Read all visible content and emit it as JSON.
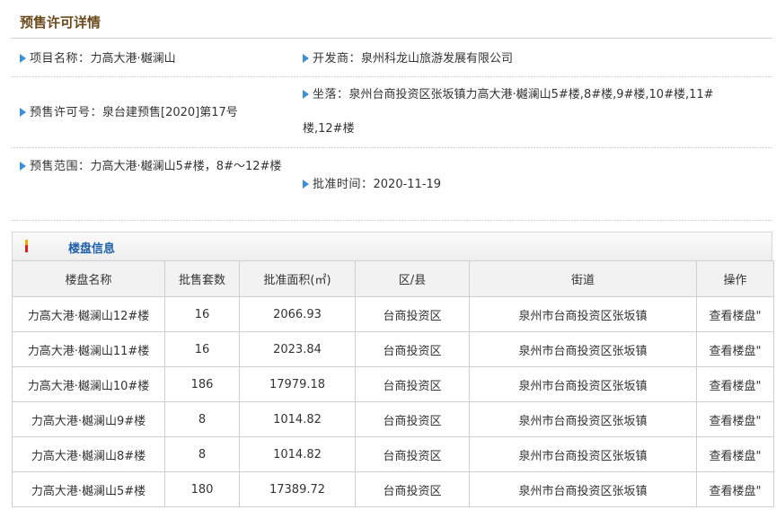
{
  "page": {
    "title": "预售许可详情"
  },
  "info": {
    "project_name_label": "项目名称：",
    "project_name_value": "力高大港·樾澜山",
    "developer_label": "开发商：",
    "developer_value": "泉州科龙山旅游发展有限公司",
    "permit_no_label": "预售许可号：",
    "permit_no_value": "泉台建预售[2020]第17号",
    "location_label": "坐落：",
    "location_value": "泉州台商投资区张坂镇力高大港·樾澜山5#楼,8#楼,9#楼,10#楼,11#楼,12#楼",
    "scope_label": "预售范围：",
    "scope_value": "力高大港·樾澜山5#楼，8#～12#楼",
    "approve_time_label": "批准时间：",
    "approve_time_value": "2020-11-19"
  },
  "building_section": {
    "title": "楼盘信息",
    "columns": [
      "楼盘名称",
      "批售套数",
      "批准面积(㎡)",
      "区/县",
      "街道",
      "操作"
    ],
    "rows": [
      {
        "name": "力高大港·樾澜山12#楼",
        "units": "16",
        "area": "2066.93",
        "district": "台商投资区",
        "street": "泉州市台商投资区张坂镇",
        "action": "查看楼盘\""
      },
      {
        "name": "力高大港·樾澜山11#楼",
        "units": "16",
        "area": "2023.84",
        "district": "台商投资区",
        "street": "泉州市台商投资区张坂镇",
        "action": "查看楼盘\""
      },
      {
        "name": "力高大港·樾澜山10#楼",
        "units": "186",
        "area": "17979.18",
        "district": "台商投资区",
        "street": "泉州市台商投资区张坂镇",
        "action": "查看楼盘\""
      },
      {
        "name": "力高大港·樾澜山9#楼",
        "units": "8",
        "area": "1014.82",
        "district": "台商投资区",
        "street": "泉州市台商投资区张坂镇",
        "action": "查看楼盘\""
      },
      {
        "name": "力高大港·樾澜山8#楼",
        "units": "8",
        "area": "1014.82",
        "district": "台商投资区",
        "street": "泉州市台商投资区张坂镇",
        "action": "查看楼盘\""
      },
      {
        "name": "力高大港·樾澜山5#楼",
        "units": "180",
        "area": "17389.72",
        "district": "台商投资区",
        "street": "泉州市台商投资区张坂镇",
        "action": "查看楼盘\""
      }
    ]
  },
  "colors": {
    "title_brown": "#6b4a1e",
    "bullet_blue": "#3d8fd6",
    "section_title_blue": "#1f5fa8",
    "header_bg": "#f2f2f2"
  },
  "icons": {
    "bullet": "triangle-right-icon",
    "section_marker": "section-marker-icon"
  }
}
